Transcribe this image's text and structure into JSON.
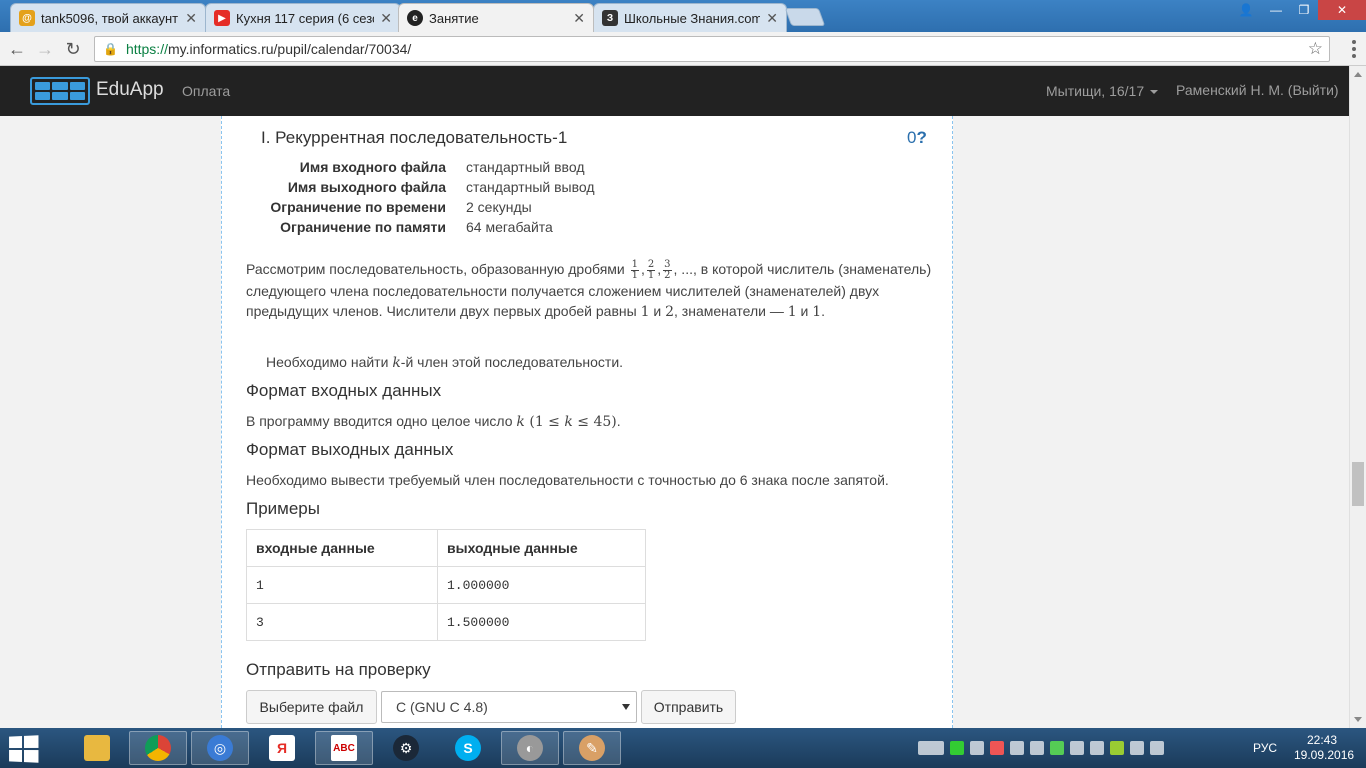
{
  "browser": {
    "tabs": [
      {
        "title": "tank5096, твой аккаунт",
        "favicon_color": "#e4a11b"
      },
      {
        "title": "Кухня 117 серия (6 сезо",
        "favicon_color": "#e52d27"
      },
      {
        "title": "Занятие",
        "favicon_color": "#222222"
      },
      {
        "title": "Школьные Знания.com",
        "favicon_color": "#333333"
      }
    ],
    "active_tab": 2,
    "url_secure": "https://",
    "url_rest": "my.informatics.ru/pupil/calendar/70034/"
  },
  "navbar": {
    "brand": "EduApp",
    "pay": "Оплата",
    "group": "Мытищи, 16/17",
    "user": "Раменский Н. М. (Выйти)"
  },
  "problem": {
    "title": "I. Рекуррентная последовательность-1",
    "score": "0",
    "score_mark": "?",
    "limits": [
      {
        "label": "Имя входного файла",
        "value": "стандартный ввод"
      },
      {
        "label": "Имя выходного файла",
        "value": "стандартный вывод"
      },
      {
        "label": "Ограничение по времени",
        "value": "2 секунды"
      },
      {
        "label": "Ограничение по памяти",
        "value": "64 мегабайта"
      }
    ],
    "statement": {
      "part1": "Рассмотрим последовательность, образованную дробями ",
      "part2": ", ..., в которой числитель (знаменатель) следующего члена последовательности получается сложением числителей (знаменателей) двух предыдущих членов. Числители двух первых дробей равны ",
      "num1": "1",
      "and": " и ",
      "num2": "2",
      "part3": ", знаменатели — ",
      "den1": "1",
      "and2": " и ",
      "den2": "1",
      "end": "."
    },
    "fractions": [
      {
        "num": "1",
        "den": "1"
      },
      {
        "num": "2",
        "den": "1"
      },
      {
        "num": "3",
        "den": "2"
      }
    ],
    "task": {
      "pre": "Необходимо найти ",
      "var": "k",
      "post": "-й член этой последовательности."
    },
    "input_heading": "Формат входных данных",
    "input_text": {
      "pre": "В программу вводится одно целое число ",
      "var": "k",
      "constraint_open": " (1 ≤ ",
      "constraint_var": "k",
      "constraint_close": " ≤ 45)",
      "end": "."
    },
    "output_heading": "Формат выходных данных",
    "output_text": "Необходимо вывести требуемый член последовательности с точностью до 6 знака после запятой.",
    "examples_heading": "Примеры",
    "examples": {
      "headers": [
        "входные данные",
        "выходные данные"
      ],
      "rows": [
        [
          "1",
          "1.000000"
        ],
        [
          "3",
          "1.500000"
        ]
      ]
    },
    "submit_heading": "Отправить на проверку",
    "choose_file": "Выберите файл",
    "compiler": "C (GNU C 4.8)",
    "submit": "Отправить"
  },
  "taskbar": {
    "lang": "РУС",
    "time": "22:43",
    "date": "19.09.2016"
  }
}
